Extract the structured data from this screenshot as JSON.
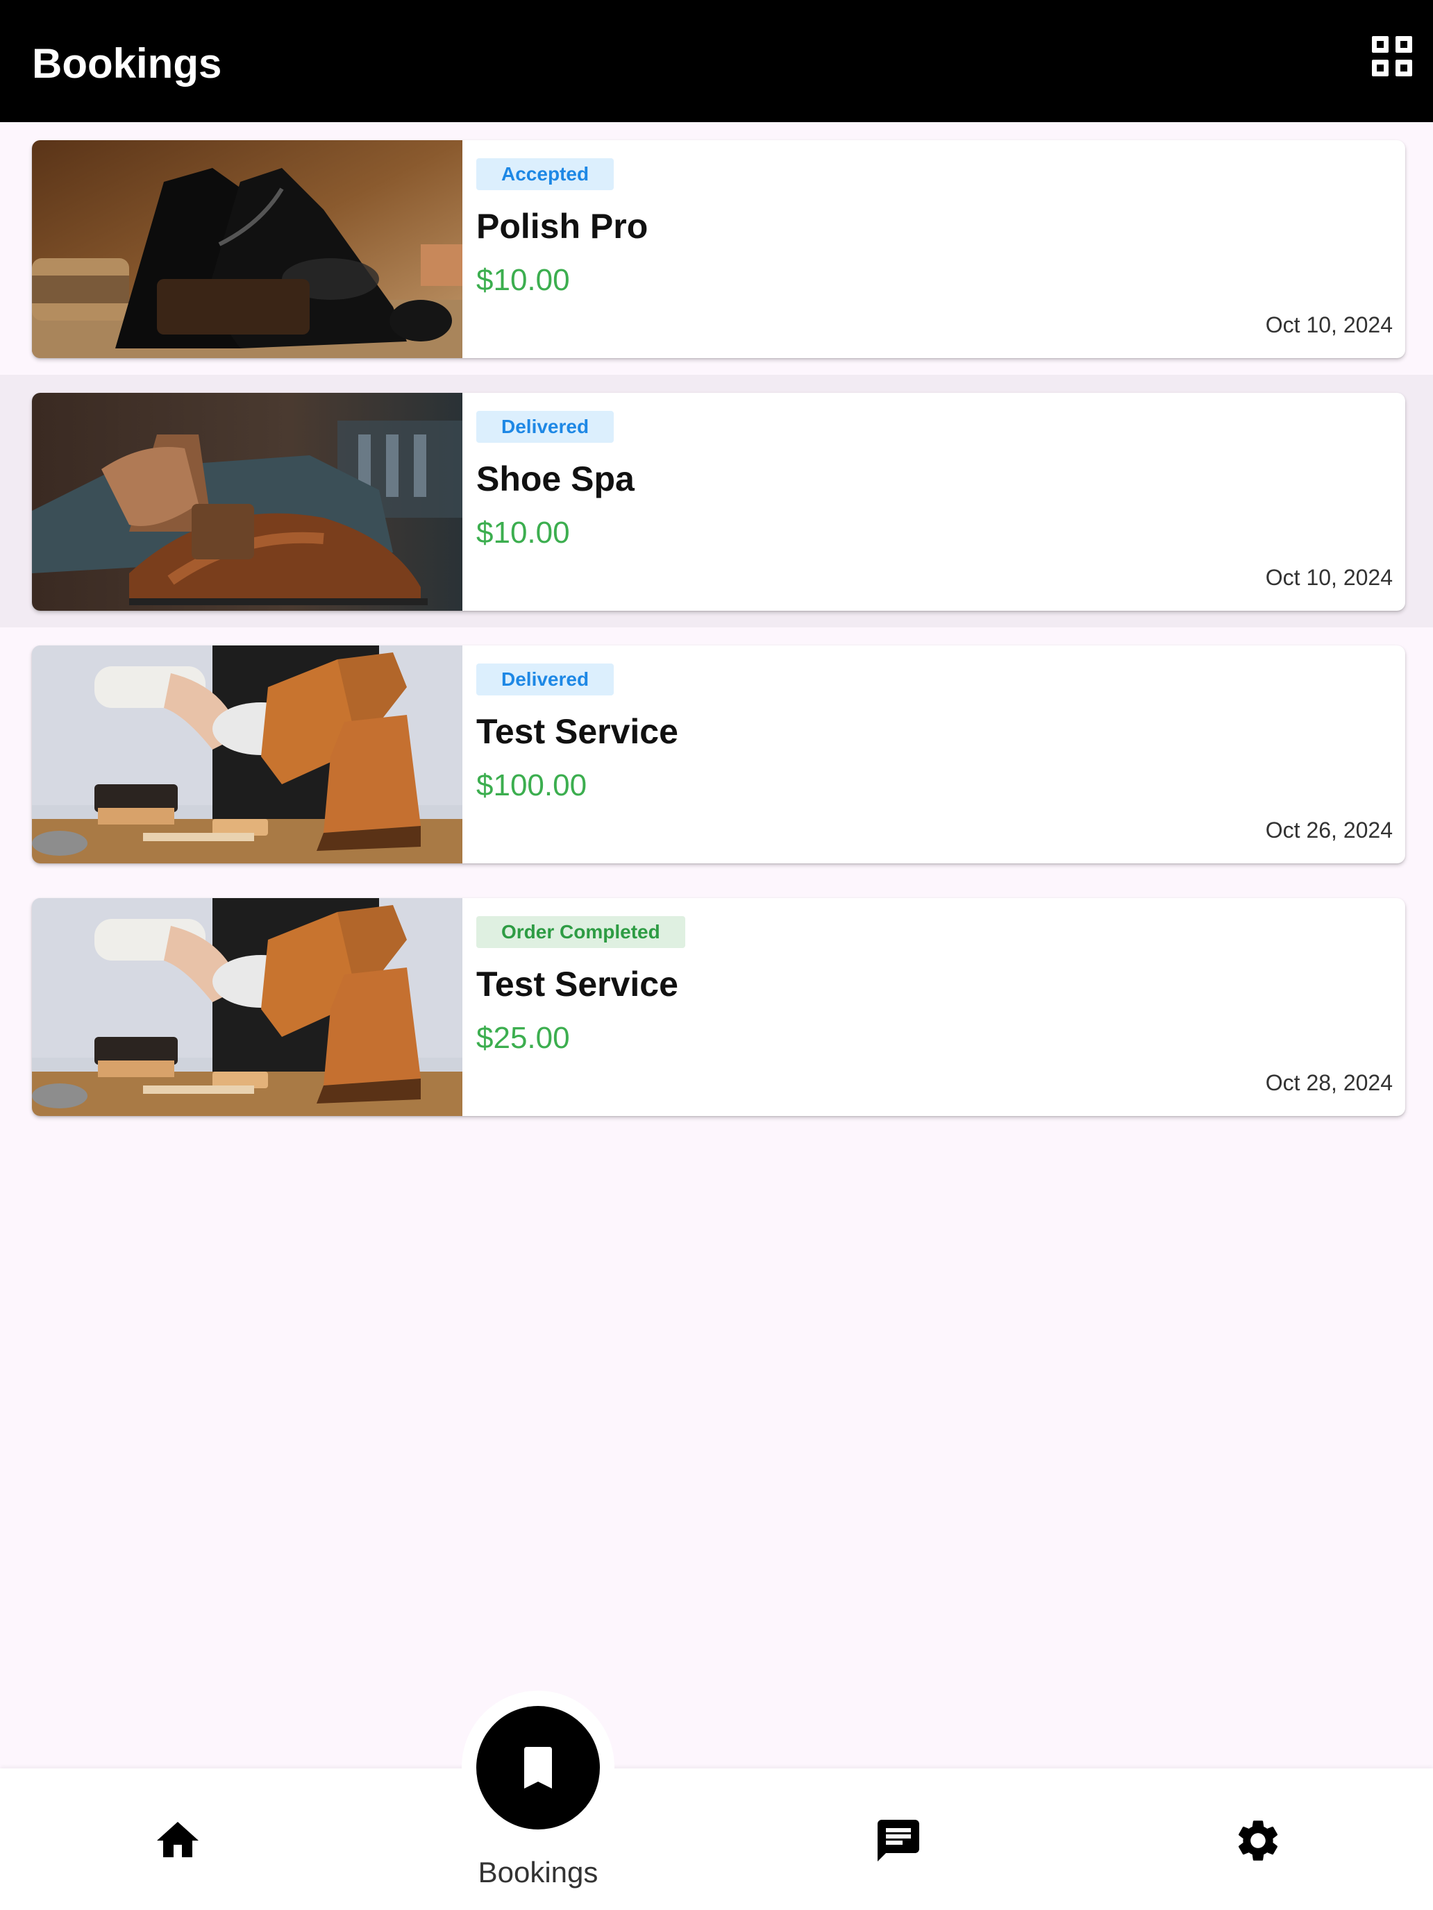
{
  "header": {
    "title": "Bookings",
    "view_toggle_icon": "grid-view-icon"
  },
  "bookings": [
    {
      "status": "Accepted",
      "status_color": "#1e88e5",
      "status_bg": "#dceffd",
      "service": "Polish Pro",
      "price": "$10.00",
      "date": "Oct 10, 2024"
    },
    {
      "status": "Delivered",
      "status_color": "#1e88e5",
      "status_bg": "#dceffd",
      "service": "Shoe Spa",
      "price": "$10.00",
      "date": "Oct 10, 2024"
    },
    {
      "status": "Delivered",
      "status_color": "#1e88e5",
      "status_bg": "#dceffd",
      "service": "Test Service",
      "price": "$100.00",
      "date": "Oct 26, 2024"
    },
    {
      "status": "Order Completed",
      "status_color": "#2e9c44",
      "status_bg": "#dff0e1",
      "service": "Test Service",
      "price": "$25.00",
      "date": "Oct 28, 2024"
    }
  ],
  "bottom_nav": {
    "items": [
      {
        "icon": "home-icon"
      },
      {
        "icon": "bookmark-icon",
        "label": "Bookings",
        "active": true
      },
      {
        "icon": "chat-icon"
      },
      {
        "icon": "settings-gear-icon"
      }
    ]
  },
  "colors": {
    "price_green": "#3cae4f",
    "app_bar": "#000000",
    "background": "#fdf6fd"
  }
}
